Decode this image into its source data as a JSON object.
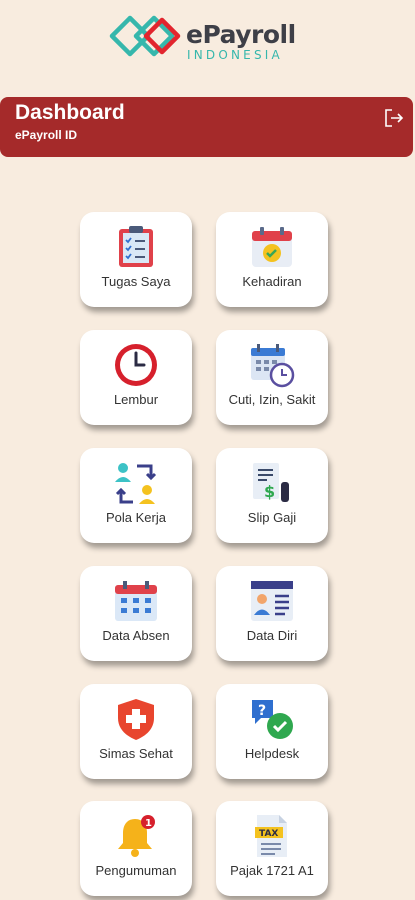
{
  "brand": {
    "name": "ePayroll",
    "subtitle": "INDONESIA"
  },
  "header": {
    "title": "Dashboard",
    "subtitle": "ePayroll ID",
    "logout_icon": "logout-icon"
  },
  "menu": [
    {
      "label": "Tugas Saya",
      "icon": "clipboard-checklist-icon"
    },
    {
      "label": "Kehadiran",
      "icon": "calendar-check-icon"
    },
    {
      "label": "Lembur",
      "icon": "clock-icon"
    },
    {
      "label": "Cuti, Izin, Sakit",
      "icon": "calendar-clock-icon"
    },
    {
      "label": "Pola Kerja",
      "icon": "shift-swap-icon"
    },
    {
      "label": "Slip Gaji",
      "icon": "payslip-icon"
    },
    {
      "label": "Data Absen",
      "icon": "calendar-grid-icon"
    },
    {
      "label": "Data Diri",
      "icon": "profile-card-icon"
    },
    {
      "label": "Simas Sehat",
      "icon": "medical-shield-icon"
    },
    {
      "label": "Helpdesk",
      "icon": "chat-help-icon"
    },
    {
      "label": "Pengumuman",
      "icon": "bell-icon",
      "badge": "1"
    },
    {
      "label": "Pajak 1721 A1",
      "icon": "tax-document-icon",
      "badge_text": "TAX"
    }
  ],
  "colors": {
    "background": "#f8ecdf",
    "header": "#a52a2a",
    "brand_teal": "#36b7ac"
  }
}
